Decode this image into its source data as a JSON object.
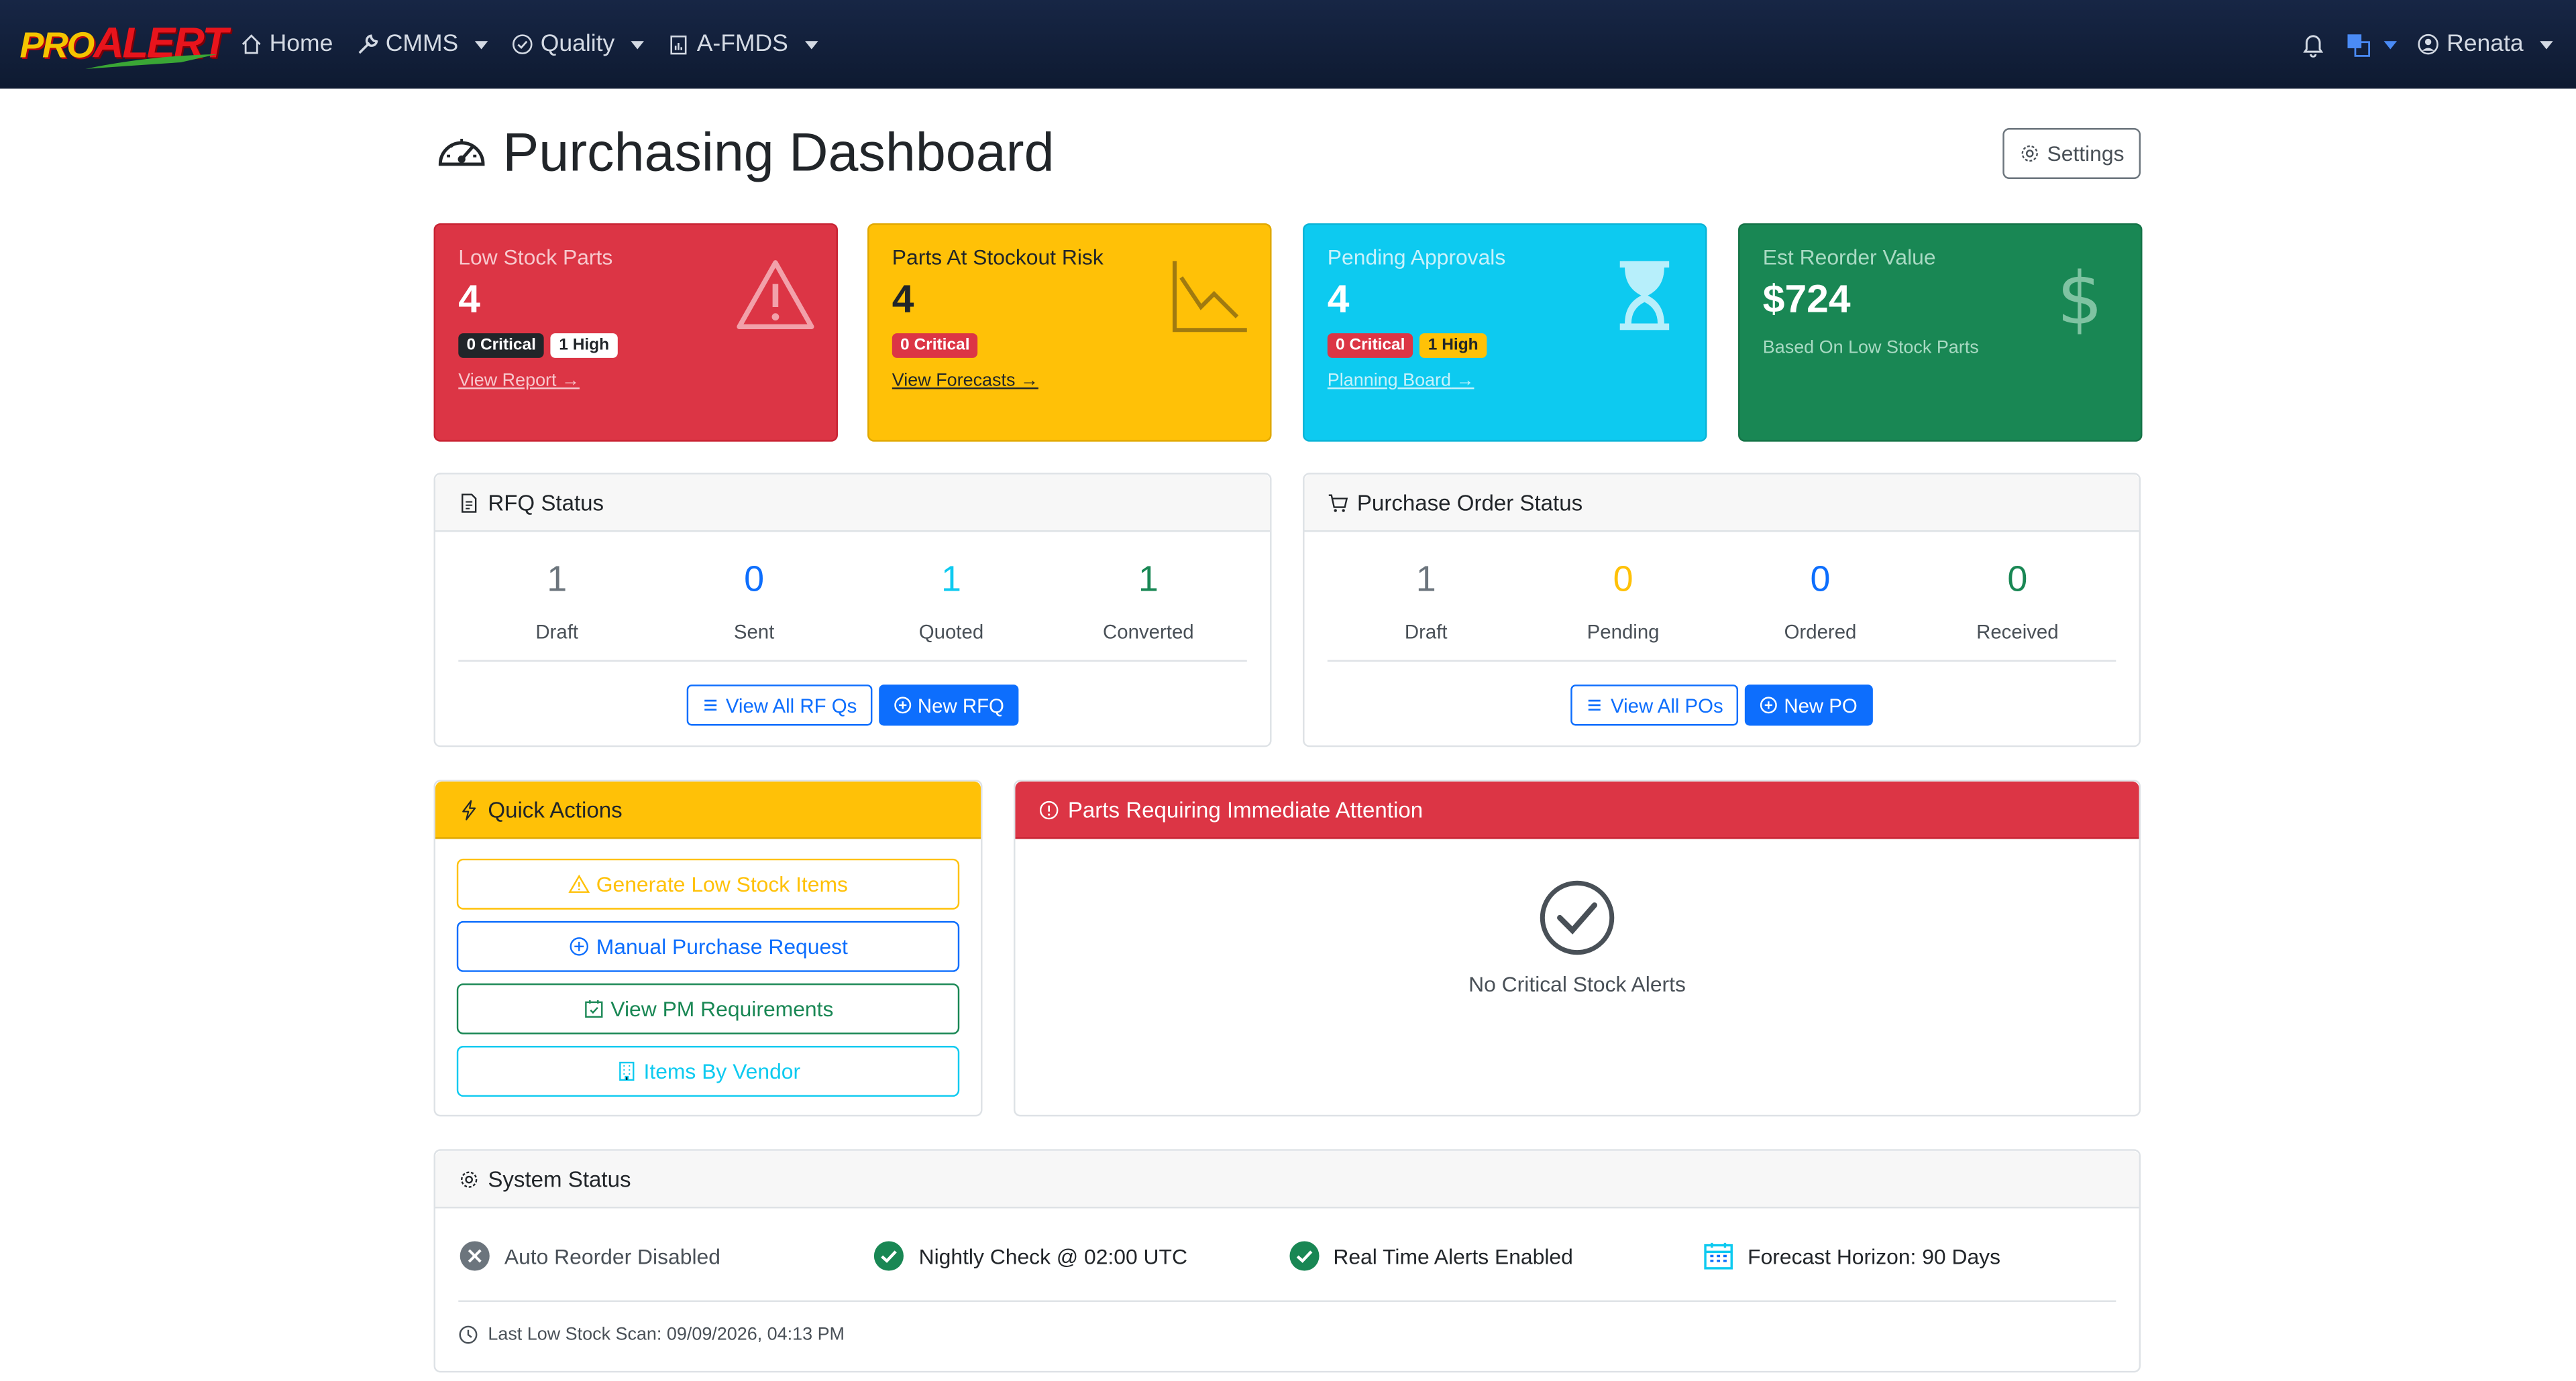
{
  "brand": {
    "logo_pro": "PRO",
    "logo_alert": "ALERT"
  },
  "nav": {
    "home": "Home",
    "cmms": "CMMS",
    "quality": "Quality",
    "afmds": "A-FMDS",
    "user": "Renata"
  },
  "header": {
    "title": "Purchasing Dashboard",
    "settings_label": "Settings"
  },
  "stats": {
    "low_stock": {
      "label": "Low Stock Parts",
      "value": "4",
      "badge_critical": "0 Critical",
      "badge_high": "1 High",
      "link": "View Report"
    },
    "stockout": {
      "label": "Parts At Stockout Risk",
      "value": "4",
      "badge_critical": "0 Critical",
      "link": "View Forecasts"
    },
    "pending": {
      "label": "Pending Approvals",
      "value": "4",
      "badge_critical": "0 Critical",
      "badge_high": "1 High",
      "link": "Planning Board"
    },
    "reorder": {
      "label": "Est Reorder Value",
      "value": "$724",
      "sub": "Based On Low Stock Parts"
    }
  },
  "rfq": {
    "title": "RFQ Status",
    "counts": [
      {
        "value": "1",
        "label": "Draft",
        "color": "#6c757d"
      },
      {
        "value": "0",
        "label": "Sent",
        "color": "#0d6efd"
      },
      {
        "value": "1",
        "label": "Quoted",
        "color": "#0dcaf0"
      },
      {
        "value": "1",
        "label": "Converted",
        "color": "#198754"
      }
    ],
    "view_all": "View All RF Qs",
    "new": "New RFQ"
  },
  "po": {
    "title": "Purchase Order Status",
    "counts": [
      {
        "value": "1",
        "label": "Draft",
        "color": "#6c757d"
      },
      {
        "value": "0",
        "label": "Pending",
        "color": "#ffc107"
      },
      {
        "value": "0",
        "label": "Ordered",
        "color": "#0d6efd"
      },
      {
        "value": "0",
        "label": "Received",
        "color": "#198754"
      }
    ],
    "view_all": "View All POs",
    "new": "New PO"
  },
  "quick_actions": {
    "title": "Quick Actions",
    "generate": "Generate Low Stock Items",
    "manual": "Manual Purchase Request",
    "pm": "View PM Requirements",
    "vendor": "Items By Vendor"
  },
  "attention": {
    "title": "Parts Requiring Immediate Attention",
    "empty": "No Critical Stock Alerts"
  },
  "system": {
    "title": "System Status",
    "auto_reorder": "Auto Reorder Disabled",
    "nightly": "Nightly Check @ 02:00 UTC",
    "realtime": "Real Time Alerts Enabled",
    "forecast": "Forecast Horizon: 90 Days",
    "last_scan": "Last Low Stock Scan: 09/09/2026, 04:13 PM"
  },
  "colors": {
    "danger": "#dc3545",
    "warning": "#ffc107",
    "info": "#0dcaf0",
    "success": "#198754",
    "primary": "#0d6efd",
    "navbar": "#172645"
  }
}
